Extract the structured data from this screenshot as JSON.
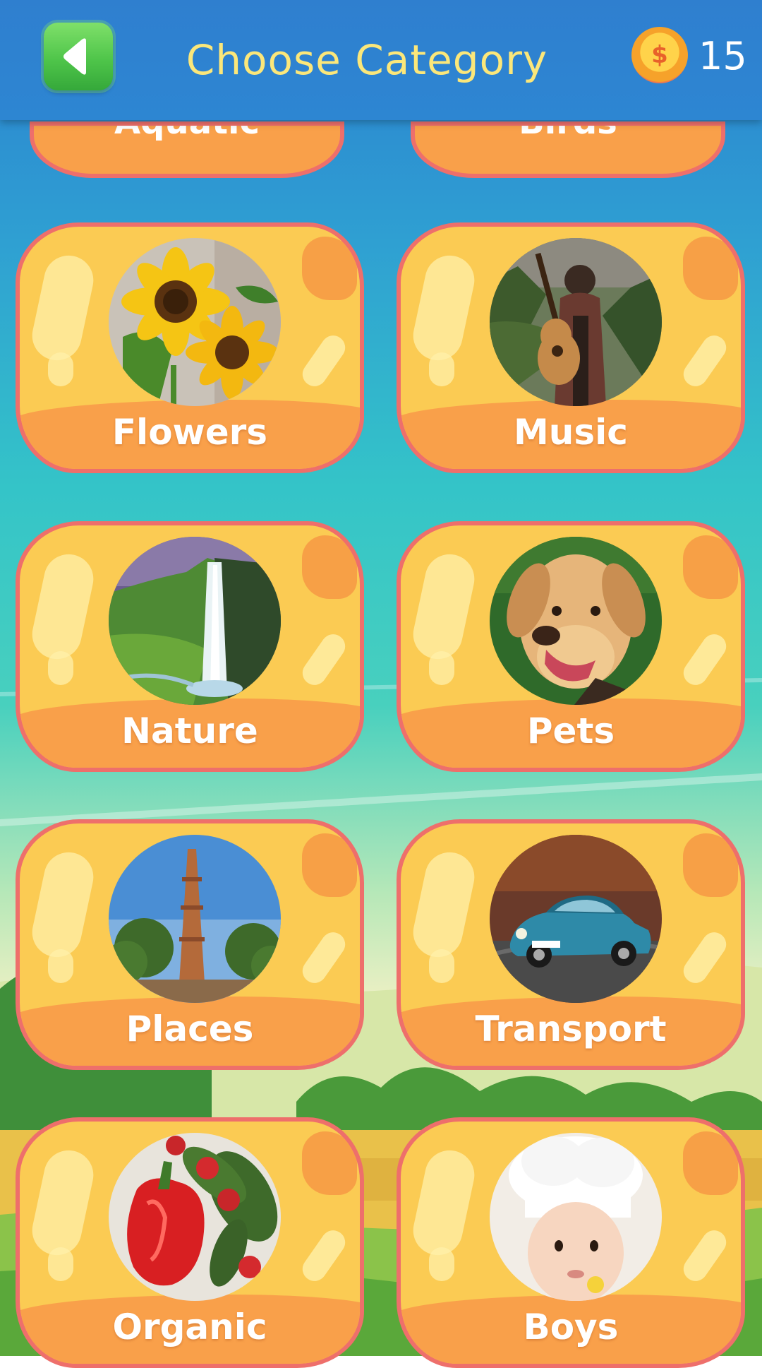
{
  "header": {
    "title": "Choose Category",
    "coins": "15",
    "coin_symbol": "$"
  },
  "partial_categories": [
    {
      "label": "Aquatic"
    },
    {
      "label": "Birds"
    }
  ],
  "categories": [
    {
      "label": "Flowers",
      "photo": "sunflower"
    },
    {
      "label": "Music",
      "photo": "guitar-player"
    },
    {
      "label": "Nature",
      "photo": "waterfall"
    },
    {
      "label": "Pets",
      "photo": "dog"
    },
    {
      "label": "Places",
      "photo": "tower"
    },
    {
      "label": "Transport",
      "photo": "car"
    },
    {
      "label": "Organic",
      "photo": "vegetables"
    },
    {
      "label": "Boys",
      "photo": "chef-boy"
    }
  ],
  "colors": {
    "header_bg": "#2f7fcf",
    "title": "#fbe77a",
    "card_fill": "#fbcb53",
    "card_band": "#f9a04a",
    "card_border": "#ee6f6b",
    "back_button": "#4fc54a"
  }
}
